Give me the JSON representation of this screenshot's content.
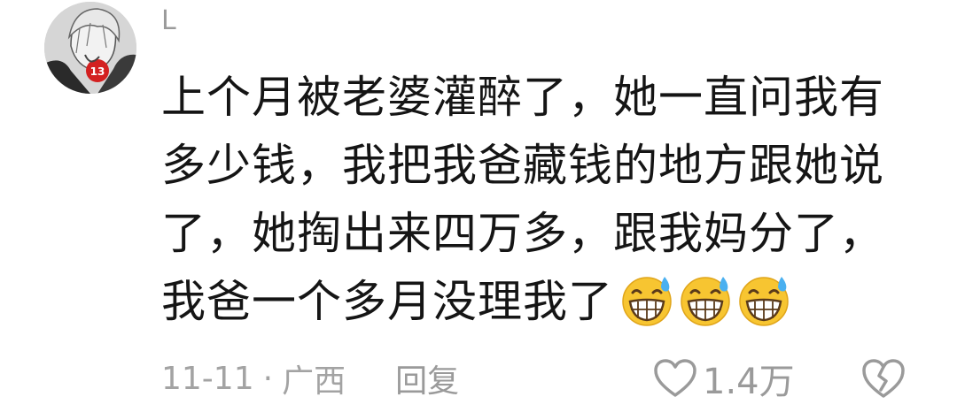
{
  "comment": {
    "username": "L",
    "avatar_icon": "anime-avatar",
    "text_lines": [
      "上个月被老婆灌醉了，她一直问我有",
      "多少钱，我把我爸藏钱的地方跟她说",
      "了，她掏出来四万多，跟我妈分了，",
      "我爸一个多月没理我了"
    ],
    "emojis": [
      "grinning-sweat-emoji",
      "grinning-sweat-emoji",
      "grinning-sweat-emoji"
    ],
    "date": "11-11",
    "separator": "·",
    "location": "广西",
    "reply_label": "回复",
    "like_icon": "heart-outline-icon",
    "like_count": "1.4万",
    "dislike_icon": "broken-heart-icon",
    "colors": {
      "text": "#151515",
      "meta": "#a3a3a3",
      "background": "#ffffff"
    }
  }
}
